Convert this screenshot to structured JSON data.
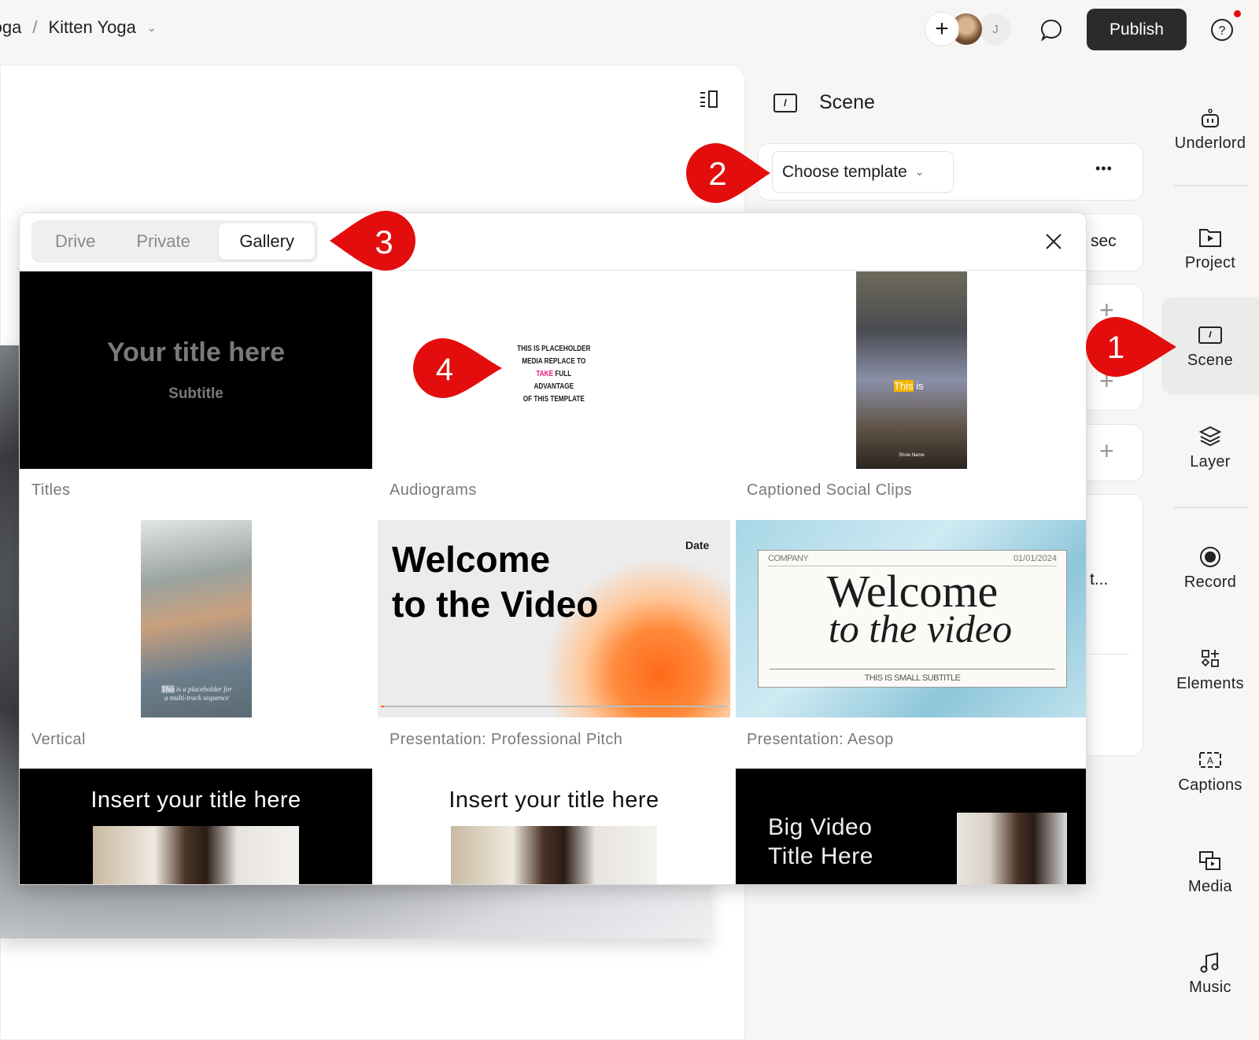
{
  "breadcrumb": {
    "parent": "Yoga",
    "current": "Kitten Yoga"
  },
  "header": {
    "avatar_initial": "J",
    "publish_label": "Publish"
  },
  "colors": {
    "annotation": "#e30d0d",
    "publish_bg": "#2b2b2b",
    "accent_pink": "#e8197a",
    "notification": "#e30d0d"
  },
  "scene_panel": {
    "title": "Scene",
    "template_dropdown": "Choose template",
    "more": "•••",
    "duration_fragment": "sec",
    "truncated_text": "t..."
  },
  "sidebar": {
    "items": [
      {
        "label": "Underlord",
        "icon": "robot-icon"
      },
      {
        "label": "Project",
        "icon": "folder-play-icon"
      },
      {
        "label": "Scene",
        "icon": "scene-icon",
        "selected": true
      },
      {
        "label": "Layer",
        "icon": "layers-icon"
      },
      {
        "label": "Record",
        "icon": "record-icon"
      },
      {
        "label": "Elements",
        "icon": "elements-icon"
      },
      {
        "label": "Captions",
        "icon": "captions-icon"
      },
      {
        "label": "Media",
        "icon": "media-icon"
      },
      {
        "label": "Music",
        "icon": "music-icon"
      }
    ]
  },
  "modal": {
    "tabs": [
      "Drive",
      "Private",
      "Gallery"
    ],
    "selected_tab": "Gallery",
    "templates": [
      {
        "label": "Titles",
        "title": "Your title here",
        "subtitle": "Subtitle"
      },
      {
        "label": "Audiograms",
        "lines": [
          "THIS IS PLACEHOLDER",
          "MEDIA REPLACE TO",
          "TAKE",
          "FULL ADVANTAGE",
          "OF THIS TEMPLATE"
        ]
      },
      {
        "label": "Captioned Social Clips",
        "caption_highlight": "This",
        "caption_rest": "is",
        "show": "Show Name"
      },
      {
        "label": "Vertical",
        "caption_highlight": "This",
        "caption_rest": "is a placeholder for",
        "caption_line2": "a multi-track sequence"
      },
      {
        "label": "Presentation: Professional Pitch",
        "title1": "Welcome",
        "title2": "to the Video",
        "date": "Date"
      },
      {
        "label": "Presentation: Aesop",
        "company": "COMPANY",
        "date": "01/01/2024",
        "title1": "Welcome",
        "title2": "to the video",
        "subtitle": "THIS IS SMALL SUBTITLE"
      },
      {
        "title": "Insert your title here"
      },
      {
        "title": "Insert your title here"
      },
      {
        "title1": "Big Video",
        "title2": "Title Here"
      }
    ]
  },
  "annotations": [
    "1",
    "2",
    "3",
    "4"
  ]
}
